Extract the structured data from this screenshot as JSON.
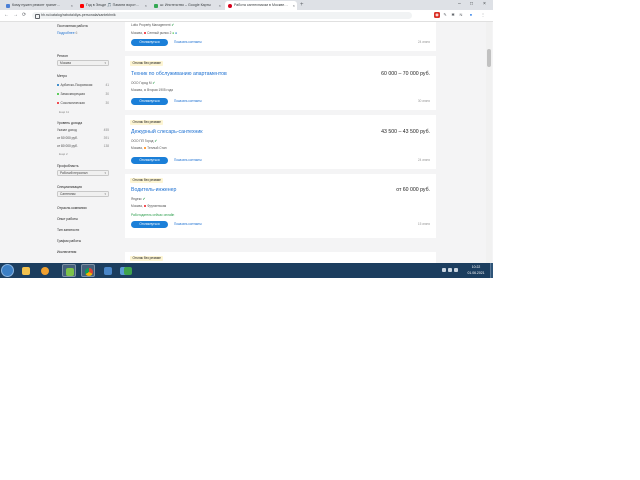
{
  "browser": {
    "tabs": [
      {
        "label": "Кому нужен ремонт гранит…",
        "active": false,
        "favicon_color": "#4a7fd6"
      },
      {
        "label": "Год в Эльде 🎵 Памяти ворот…",
        "active": false,
        "favicon_color": "#ff0000"
      },
      {
        "label": "ш: Ипотечство – Google Карты",
        "active": false,
        "favicon_color": "#34a853"
      },
      {
        "label": "Работа сантехником в Москве…",
        "active": true,
        "favicon_color": "#d6001c"
      }
    ],
    "new_tab_symbol": "+",
    "window_controls": {
      "minimize": "–",
      "maximize": "□",
      "close": "×"
    },
    "nav": {
      "back": "←",
      "forward": "→",
      "reload": "⟳"
    },
    "url": "hh.ru/catalog/rabota/dlya-personala/santekhnik",
    "extensions": [
      {
        "name": "extension-icon",
        "color": "#d93025",
        "glyph": "◉"
      },
      {
        "name": "extension-icon",
        "color": "#5f6368",
        "glyph": "✎"
      },
      {
        "name": "puzzle-icon",
        "color": "#5f6368",
        "glyph": "✱"
      },
      {
        "name": "extension-icon",
        "color": "#5f6368",
        "glyph": "N"
      },
      {
        "name": "profile-icon",
        "color": "#1a73e8",
        "glyph": "●"
      },
      {
        "name": "menu-icon",
        "color": "#5f6368",
        "glyph": "⋮"
      }
    ]
  },
  "sidebar": {
    "top_text": "Постоянная работа",
    "top_link": "Подробнее",
    "top_link_count": "6",
    "region_title": "Регион",
    "region_value": "Москва",
    "metro_title": "Метро",
    "metro_items": [
      {
        "label": "Арбатско-Покровская",
        "count": "41",
        "color": "#0a6fc2"
      },
      {
        "label": "Замоскворецкая",
        "count": "30",
        "color": "#2dbe2c"
      },
      {
        "label": "Сокольническая",
        "count": "30",
        "color": "#ef161e"
      }
    ],
    "metro_more": "Ещё 11",
    "income_title": "Уровень дохода",
    "income_items": [
      {
        "label": "Указан доход",
        "count": "455"
      },
      {
        "label": "от 50 000 руб.",
        "count": "391"
      },
      {
        "label": "от 80 000 руб.",
        "count": "138"
      }
    ],
    "income_more": "Ещё 2",
    "profession_title": "Профобласть",
    "profession_value": "Рабочий персонал",
    "spec_title": "Специализация",
    "spec_value": "Сантехник",
    "more_filters": [
      "Отрасль компании",
      "Опыт работы",
      "Тип занятости",
      "График работы",
      "Исключения"
    ]
  },
  "vacancies": [
    {
      "badge": "",
      "title": "",
      "salary": "",
      "company": "Lotto Property Management",
      "location": "Москва",
      "metro": "Сенный рынок 2",
      "metro_color": "#ef161e",
      "note": "",
      "respond_label": "Откликнуться",
      "contacts_label": "Показать контакты",
      "posted": "24 июня"
    },
    {
      "badge": "Отклик без резюме",
      "title": "Техник по обслуживанию апартаментов",
      "salary": "60 000 – 70 000 руб.",
      "company": "ООО Город М",
      "location": "Москва",
      "metro": "Вторая 1905 года",
      "metro_color": "#a1a2a3",
      "note": "",
      "respond_label": "Откликнуться",
      "contacts_label": "Показать контакты",
      "posted": "30 июня"
    },
    {
      "badge": "Отклик без резюме",
      "title": "Дежурный слесарь-сантехник",
      "salary": "43 500 – 43 500 руб.",
      "company": "ООО ПП Город",
      "location": "Москва",
      "metro": "Теплый Стан",
      "metro_color": "#ff7f00",
      "note": "",
      "respond_label": "Откликнуться",
      "contacts_label": "Показать контакты",
      "posted": "24 июня"
    },
    {
      "badge": "Отклик без резюме",
      "title": "Водитель-инженер",
      "salary": "от 60 000 руб.",
      "company": "Яндекс",
      "location": "Москва",
      "metro": "Фрунзенская",
      "metro_color": "#ef161e",
      "note": "Работодатель сейчас онлайн",
      "respond_label": "Откликнуться",
      "contacts_label": "Показать контакты",
      "posted": "15 июня"
    },
    {
      "badge": "Отклик без резюме"
    }
  ],
  "taskbar": {
    "items": [
      {
        "name": "windows-explorer",
        "color": "#f2c14e",
        "active": false
      },
      {
        "name": "media-player",
        "color": "#f0a030",
        "active": false
      },
      {
        "name": "app-icon",
        "color": "#7cc24a",
        "active": true
      },
      {
        "name": "chrome",
        "color": "#db4437",
        "active": true
      },
      {
        "name": "app-icon",
        "color": "#4a86c8",
        "active": false
      },
      {
        "name": "mail",
        "color": "#5b9bd5",
        "active": false
      },
      {
        "name": "app-icon",
        "color": "#3fa34d",
        "active": false
      }
    ],
    "clock_time": "10:22",
    "clock_date": "01.06.2021"
  }
}
